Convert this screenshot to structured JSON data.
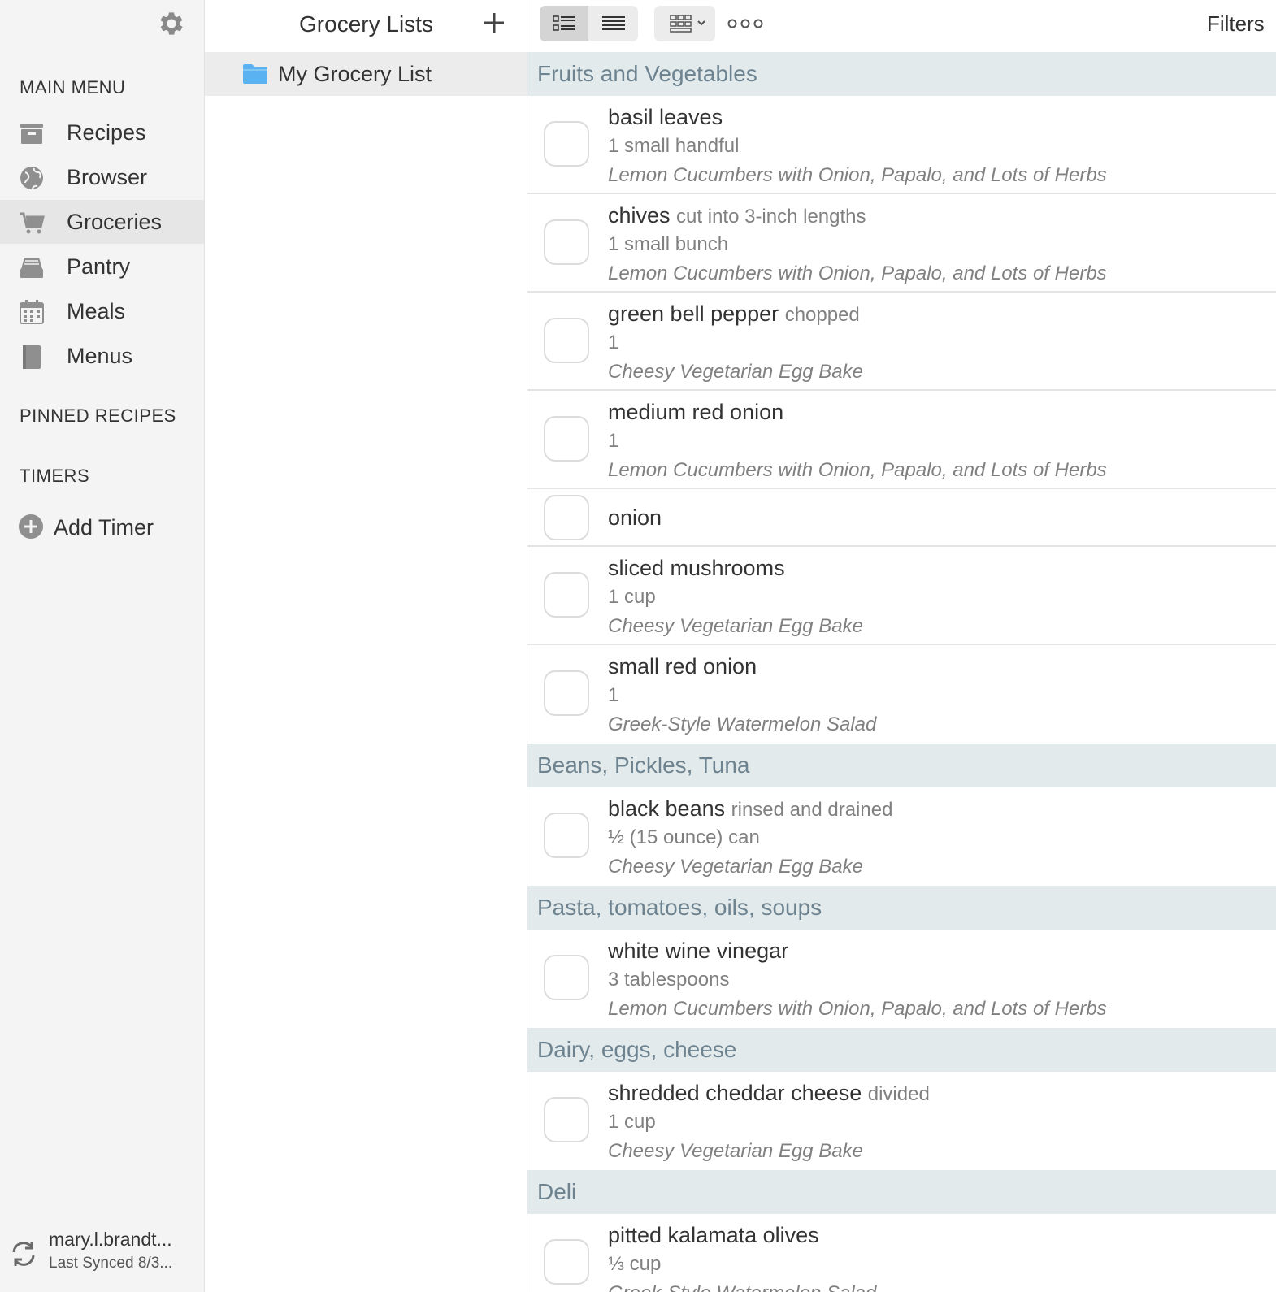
{
  "sidebar": {
    "main_menu_heading": "MAIN MENU",
    "items": [
      {
        "label": "Recipes",
        "icon": "archive-icon"
      },
      {
        "label": "Browser",
        "icon": "globe-icon"
      },
      {
        "label": "Groceries",
        "icon": "cart-icon",
        "active": true
      },
      {
        "label": "Pantry",
        "icon": "pantry-tray-icon"
      },
      {
        "label": "Meals",
        "icon": "calendar-icon"
      },
      {
        "label": "Menus",
        "icon": "book-icon"
      }
    ],
    "pinned_heading": "PINNED RECIPES",
    "timers_heading": "TIMERS",
    "add_timer_label": "Add Timer",
    "sync": {
      "user": "mary.l.brandt...",
      "status": "Last Synced 8/3..."
    }
  },
  "lists": {
    "title": "Grocery Lists",
    "items": [
      {
        "name": "My Grocery List",
        "selected": true
      }
    ]
  },
  "toolbar": {
    "filters_label": "Filters"
  },
  "groceries": {
    "categories": [
      {
        "name": "Fruits and Vegetables",
        "items": [
          {
            "name": "basil leaves",
            "note": "",
            "quantity": "1 small handful",
            "recipe": "Lemon Cucumbers with Onion, Papalo, and Lots of Herbs"
          },
          {
            "name": "chives",
            "note": "cut into 3-inch lengths",
            "quantity": "1 small bunch",
            "recipe": "Lemon Cucumbers with Onion, Papalo, and Lots of Herbs"
          },
          {
            "name": "green bell pepper",
            "note": "chopped",
            "quantity": "1",
            "recipe": "Cheesy Vegetarian Egg Bake"
          },
          {
            "name": "medium red onion",
            "note": "",
            "quantity": "1",
            "recipe": "Lemon Cucumbers with Onion, Papalo, and Lots of Herbs"
          },
          {
            "name": "onion",
            "note": "",
            "quantity": "",
            "recipe": ""
          },
          {
            "name": "sliced mushrooms",
            "note": "",
            "quantity": "1 cup",
            "recipe": "Cheesy Vegetarian Egg Bake"
          },
          {
            "name": "small red onion",
            "note": "",
            "quantity": "1",
            "recipe": "Greek-Style Watermelon Salad"
          }
        ]
      },
      {
        "name": "Beans, Pickles, Tuna",
        "items": [
          {
            "name": "black beans",
            "note": "rinsed and drained",
            "quantity": "½ (15 ounce) can",
            "recipe": "Cheesy Vegetarian Egg Bake"
          }
        ]
      },
      {
        "name": "Pasta, tomatoes, oils, soups",
        "items": [
          {
            "name": "white wine vinegar",
            "note": "",
            "quantity": "3 tablespoons",
            "recipe": "Lemon Cucumbers with Onion, Papalo, and Lots of Herbs"
          }
        ]
      },
      {
        "name": "Dairy, eggs, cheese",
        "items": [
          {
            "name": "shredded cheddar cheese",
            "note": "divided",
            "quantity": "1 cup",
            "recipe": "Cheesy Vegetarian Egg Bake"
          }
        ]
      },
      {
        "name": "Deli",
        "items": [
          {
            "name": "pitted kalamata olives",
            "note": "",
            "quantity": "⅓ cup",
            "recipe": "Greek-Style Watermelon Salad"
          }
        ]
      }
    ]
  },
  "colors": {
    "sidebar_bg": "#f4f4f4",
    "active_bg": "#e6e6e6",
    "category_bg": "#e3eaec",
    "category_text": "#6d8390",
    "folder_blue": "#5ab3f0"
  }
}
